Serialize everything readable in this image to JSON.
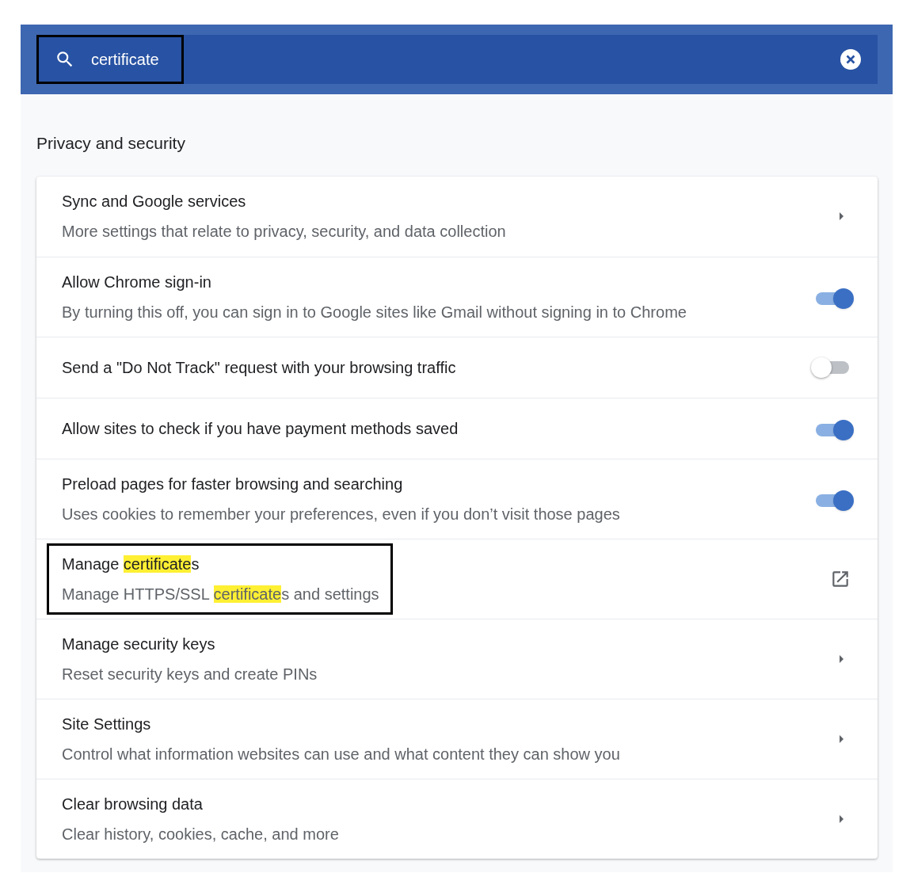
{
  "search": {
    "value": "certificate",
    "outlined": true
  },
  "section": {
    "title": "Privacy and security"
  },
  "rows": [
    {
      "kind": "arrow",
      "outlined": false,
      "title": [
        {
          "text": "Sync and Google services",
          "highlighted": false
        }
      ],
      "subtitle": [
        {
          "text": "More settings that relate to privacy, security, and data collection",
          "highlighted": false
        }
      ]
    },
    {
      "kind": "toggle",
      "on": true,
      "outlined": false,
      "title": [
        {
          "text": "Allow Chrome sign-in",
          "highlighted": false
        }
      ],
      "subtitle": [
        {
          "text": "By turning this off, you can sign in to Google sites like Gmail without signing in to Chrome",
          "highlighted": false
        }
      ]
    },
    {
      "kind": "toggle",
      "on": false,
      "outlined": false,
      "title": [
        {
          "text": "Send a \"Do Not Track\" request with your browsing traffic",
          "highlighted": false
        }
      ]
    },
    {
      "kind": "toggle",
      "on": true,
      "outlined": false,
      "title": [
        {
          "text": "Allow sites to check if you have payment methods saved",
          "highlighted": false
        }
      ]
    },
    {
      "kind": "toggle",
      "on": true,
      "outlined": false,
      "title": [
        {
          "text": "Preload pages for faster browsing and searching",
          "highlighted": false
        }
      ],
      "subtitle": [
        {
          "text": "Uses cookies to remember your preferences, even if you don’t visit those pages",
          "highlighted": false
        }
      ]
    },
    {
      "kind": "external",
      "outlined": true,
      "title": [
        {
          "text": "Manage ",
          "highlighted": false
        },
        {
          "text": "certificate",
          "highlighted": true
        },
        {
          "text": "s",
          "highlighted": false
        }
      ],
      "subtitle": [
        {
          "text": "Manage HTTPS/SSL ",
          "highlighted": false
        },
        {
          "text": "certificate",
          "highlighted": true
        },
        {
          "text": "s and settings",
          "highlighted": false
        }
      ]
    },
    {
      "kind": "arrow",
      "outlined": false,
      "title": [
        {
          "text": "Manage security keys",
          "highlighted": false
        }
      ],
      "subtitle": [
        {
          "text": "Reset security keys and create PINs",
          "highlighted": false
        }
      ]
    },
    {
      "kind": "arrow",
      "outlined": false,
      "title": [
        {
          "text": "Site Settings",
          "highlighted": false
        }
      ],
      "subtitle": [
        {
          "text": "Control what information websites can use and what content they can show you",
          "highlighted": false
        }
      ]
    },
    {
      "kind": "arrow",
      "outlined": false,
      "title": [
        {
          "text": "Clear browsing data",
          "highlighted": false
        }
      ],
      "subtitle": [
        {
          "text": "Clear history, cookies, cache, and more",
          "highlighted": false
        }
      ]
    }
  ]
}
